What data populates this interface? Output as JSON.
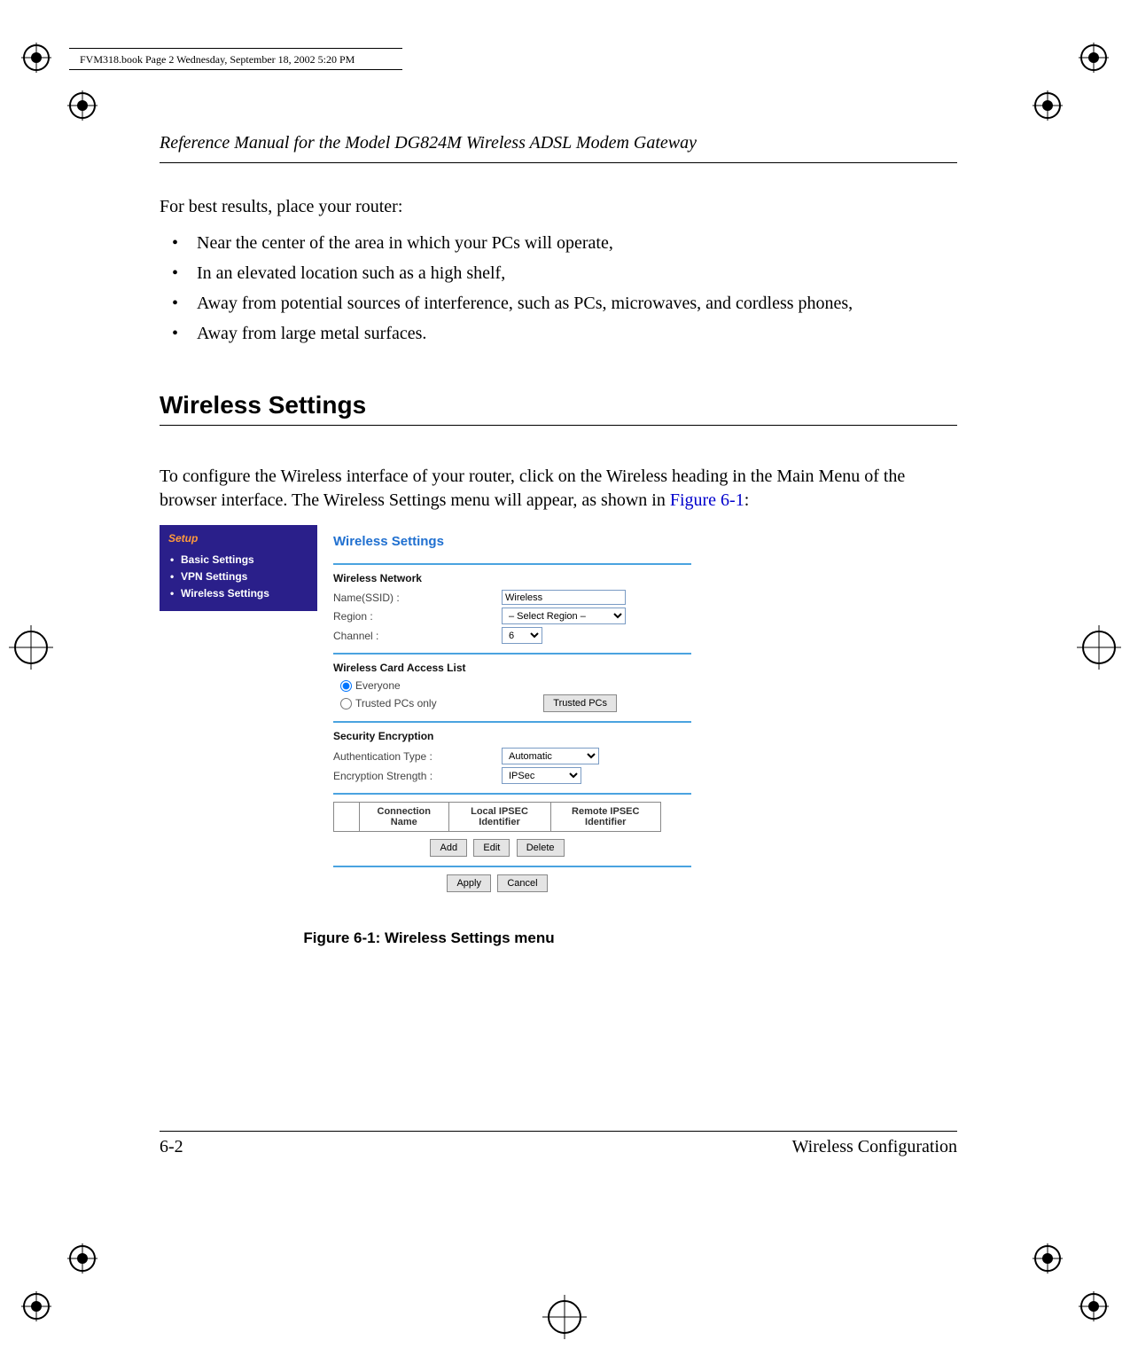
{
  "print_header": "FVM318.book  Page 2  Wednesday, September 18, 2002  5:20 PM",
  "running_head": "Reference Manual for the Model DG824M Wireless ADSL Modem Gateway",
  "intro": "For best results, place your router:",
  "bullets": [
    "Near the center of the area in which your PCs will operate,",
    "In an elevated location such as a high shelf,",
    "Away from potential sources of interference, such as PCs, microwaves, and cordless phones,",
    "Away from large metal surfaces."
  ],
  "section_heading": "Wireless Settings",
  "settings_para_pre": "To configure the Wireless interface of your router, click on the Wireless heading in the Main Menu of the browser interface. The Wireless Settings menu will appear, as shown in ",
  "settings_para_link": "Figure 6-1",
  "settings_para_post": ":",
  "figure_caption": "Figure 6-1:  Wireless Settings menu",
  "footer": {
    "page_num": "6-2",
    "chapter": "Wireless Configuration"
  },
  "screenshot": {
    "sidebar": {
      "heading": "Setup",
      "items": [
        "Basic Settings",
        "VPN Settings",
        "Wireless Settings"
      ]
    },
    "title": "Wireless Settings",
    "wireless_network": {
      "heading": "Wireless Network",
      "ssid_label": "Name(SSID) :",
      "ssid_value": "Wireless",
      "region_label": "Region :",
      "region_value": "– Select Region –",
      "channel_label": "Channel :",
      "channel_value": "6"
    },
    "access_list": {
      "heading": "Wireless Card Access List",
      "opt_everyone": "Everyone",
      "opt_trusted": "Trusted PCs only",
      "trusted_btn": "Trusted PCs"
    },
    "security": {
      "heading": "Security Encryption",
      "auth_label": "Authentication Type :",
      "auth_value": "Automatic",
      "enc_label": "Encryption Strength :",
      "enc_value": "IPSec"
    },
    "ipsec_table": {
      "col1": "Connection Name",
      "col2": "Local IPSEC Identifier",
      "col3": "Remote IPSEC Identifier"
    },
    "buttons": {
      "add": "Add",
      "edit": "Edit",
      "delete": "Delete",
      "apply": "Apply",
      "cancel": "Cancel"
    }
  }
}
